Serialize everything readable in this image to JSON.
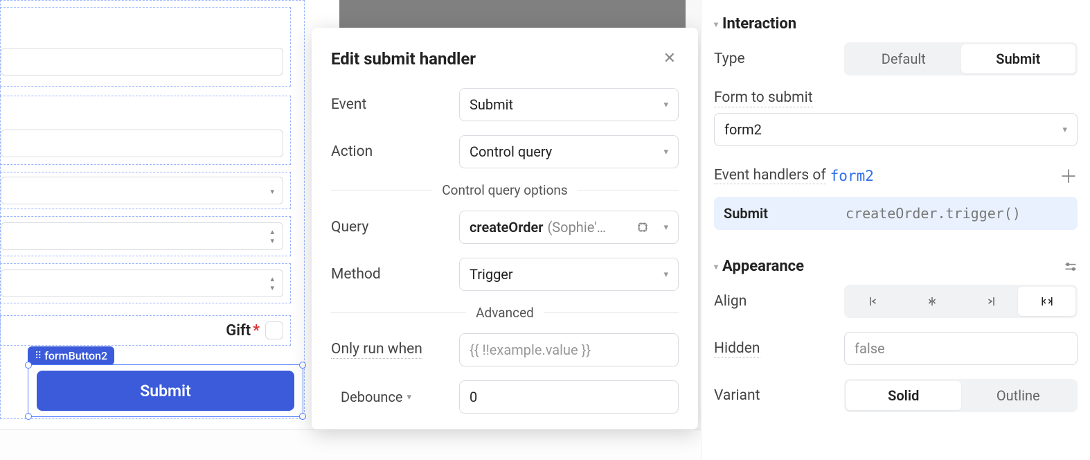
{
  "canvas": {
    "selected_component_tag": "formButton2",
    "submit_button_label": "Submit",
    "gift_label": "Gift",
    "required_mark": "*"
  },
  "modal": {
    "title": "Edit submit handler",
    "labels": {
      "event": "Event",
      "action": "Action",
      "query": "Query",
      "method": "Method",
      "only_run_when": "Only run when",
      "debounce": "Debounce"
    },
    "values": {
      "event": "Submit",
      "action": "Control query",
      "query_name": "createOrder",
      "query_source": "(Sophie'…",
      "method": "Trigger",
      "only_run_when_placeholder": "{{ !!example.value }}",
      "debounce": "0"
    },
    "section_control_query": "Control query options",
    "section_advanced": "Advanced"
  },
  "panel": {
    "section_interaction": "Interaction",
    "section_appearance": "Appearance",
    "labels": {
      "type": "Type",
      "form_to_submit": "Form to submit",
      "event_handlers_of": "Event handlers of",
      "align": "Align",
      "hidden": "Hidden",
      "variant": "Variant"
    },
    "type_options": {
      "default": "Default",
      "submit": "Submit"
    },
    "form_value": "form2",
    "event_handlers_link": "form2",
    "handler": {
      "name": "Submit",
      "code": "createOrder.trigger()"
    },
    "hidden_value": "false",
    "variant_options": {
      "solid": "Solid",
      "outline": "Outline"
    }
  }
}
